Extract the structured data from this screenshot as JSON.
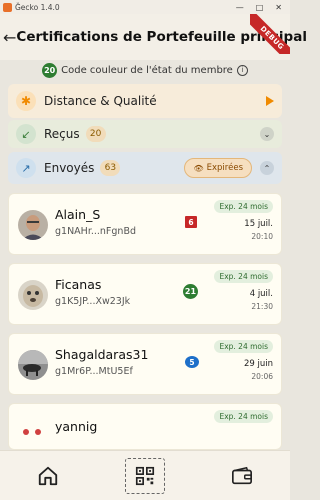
{
  "window": {
    "title": "Ğecko 1.4.0"
  },
  "header": {
    "title": "Certifications de Portefeuille principal",
    "back_icon": "arrow-left-icon",
    "debug_banner": "DEBUG"
  },
  "legend": {
    "badge": "20",
    "text": "Code couleur de l'état du membre"
  },
  "sections": {
    "distance": {
      "label": "Distance & Qualité"
    },
    "recus": {
      "label": "Reçus",
      "count": "20"
    },
    "envoyes": {
      "label": "Envoyés",
      "count": "63",
      "expired_label": "Expirées"
    }
  },
  "certifications": [
    {
      "name": "Alain_S",
      "pubkey": "g1NAHr...nFgnBd",
      "status": "6",
      "status_color": "#c62828",
      "expiry": "Exp. 24 mois",
      "date": "15 juil.",
      "time": "20:10"
    },
    {
      "name": "Ficanas",
      "pubkey": "g1K5JP...Xw23Jk",
      "status": "21",
      "status_color": "#2e7d32",
      "expiry": "Exp. 24 mois",
      "date": "4 juil.",
      "time": "21:30"
    },
    {
      "name": "Shagaldaras31",
      "pubkey": "g1Mr6P...MtU5Ef",
      "status": "5",
      "status_color": "#1e6fc9",
      "expiry": "Exp. 24 mois",
      "date": "29 juin",
      "time": "20:06"
    },
    {
      "name": "yannig",
      "expiry": "Exp. 24 mois"
    }
  ],
  "bottom_nav": [
    {
      "icon": "home-icon"
    },
    {
      "icon": "qr-code-icon"
    },
    {
      "icon": "wallet-icon"
    }
  ]
}
